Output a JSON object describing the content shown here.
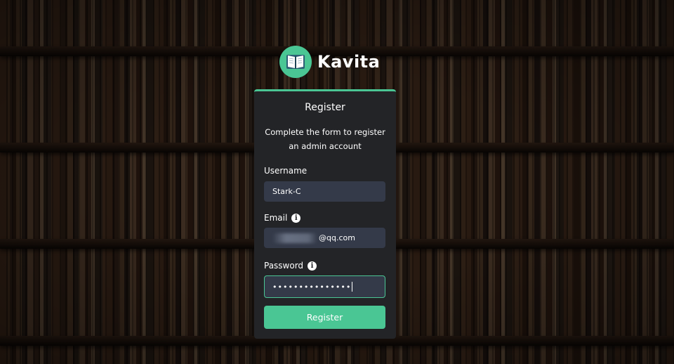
{
  "app": {
    "name": "Kavita",
    "logo_icon": "open-book-icon",
    "accent_color": "#4ac694"
  },
  "form": {
    "title": "Register",
    "description": "Complete the form to register an admin account",
    "username": {
      "label": "Username",
      "value": "Stark-C"
    },
    "email": {
      "label": "Email",
      "value_visible": "@qq.com",
      "value_redacted": true,
      "info_icon": "info-icon"
    },
    "password": {
      "label": "Password",
      "masked_value": "•••••••••••••••",
      "info_icon": "info-icon",
      "focused": true
    },
    "submit_label": "Register"
  }
}
